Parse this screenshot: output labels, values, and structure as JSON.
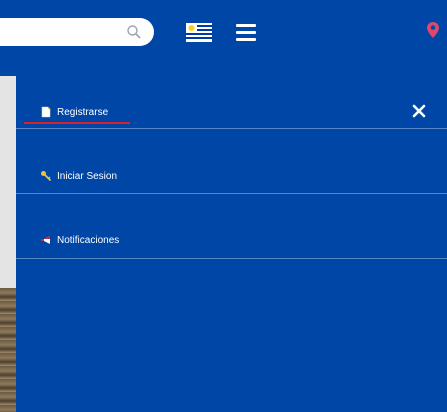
{
  "header": {
    "search_placeholder": "",
    "icons": {
      "search": "search-icon",
      "flag": "uruguay-flag-icon",
      "menu": "hamburger-menu-icon",
      "location": "location-pin-icon"
    }
  },
  "drawer": {
    "items": [
      {
        "label": "Registrarse",
        "icon": "document-icon"
      },
      {
        "label": "Iniciar Sesion",
        "icon": "key-icon"
      },
      {
        "label": "Notificaciones",
        "icon": "megaphone-icon"
      }
    ],
    "close_icon": "close-icon"
  },
  "colors": {
    "primary_blue": "#0046a6",
    "accent_red": "#d8232a",
    "white": "#ffffff"
  }
}
